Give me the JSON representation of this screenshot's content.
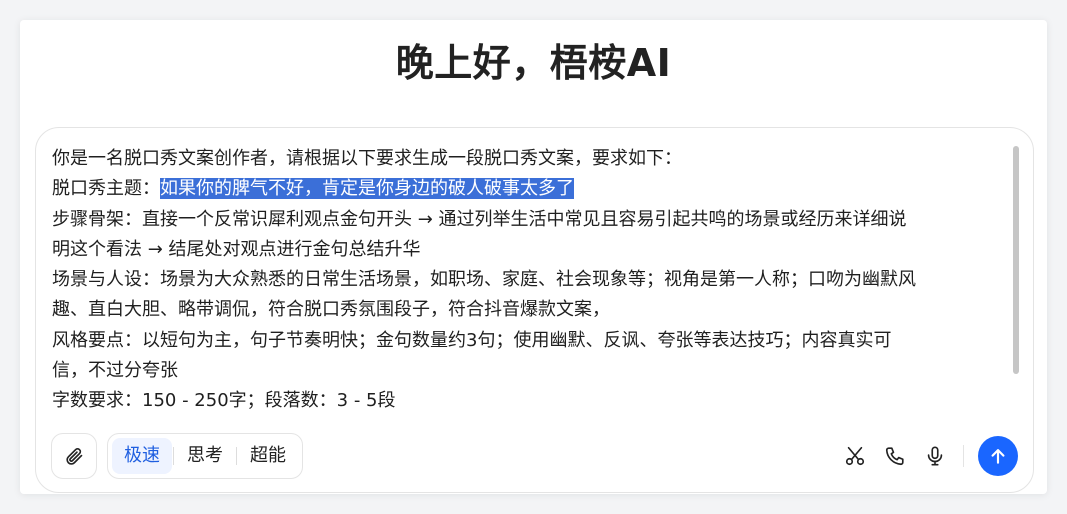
{
  "greeting": "晚上好，梧桉AI",
  "prompt": {
    "line1": "你是一名脱口秀文案创作者，请根据以下要求生成一段脱口秀文案，要求如下：",
    "theme_label": "脱口秀主题：",
    "theme_value": "如果你的脾气不好，肯定是你身边的破人破事太多了",
    "line3": "步骤骨架：直接一个反常识犀利观点金句开头 → 通过列举生活中常见且容易引起共鸣的场景或经历来详细说",
    "line4": "明这个看法 → 结尾处对观点进行金句总结升华",
    "line5": "场景与人设：场景为大众熟悉的日常生活场景，如职场、家庭、社会现象等；视角是第一人称；口吻为幽默风",
    "line6": "趣、直白大胆、略带调侃，符合脱口秀氛围段子，符合抖音爆款文案，",
    "line7": "风格要点：以短句为主，句子节奏明快；金句数量约3句；使用幽默、反讽、夸张等表达技巧；内容真实可",
    "line8": "信，不过分夸张",
    "line9": "字数要求：150 - 250字；段落数：3 - 5段"
  },
  "toolbar": {
    "modes": [
      "极速",
      "思考",
      "超能"
    ],
    "active_mode": "极速",
    "icons": [
      "paperclip-icon",
      "scissors-icon",
      "phone-icon",
      "microphone-icon",
      "arrow-up-icon"
    ]
  },
  "colors": {
    "accent": "#1a66ff",
    "selection": "#3b6fd8",
    "active_mode_bg": "#eef3ff",
    "active_mode_text": "#1f5fe0"
  }
}
